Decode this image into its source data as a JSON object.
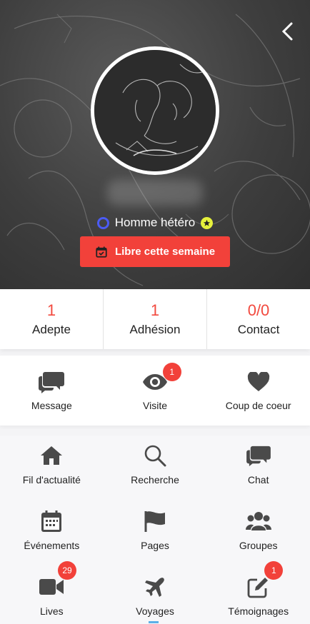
{
  "hero": {
    "orientation_label": "Homme hétéro",
    "availability_button": "Libre cette semaine"
  },
  "stats": [
    {
      "value": "1",
      "label": "Adepte"
    },
    {
      "value": "1",
      "label": "Adhésion"
    },
    {
      "value": "0/0",
      "label": "Contact"
    }
  ],
  "actions": [
    {
      "label": "Message",
      "icon": "chat-bubbles-icon"
    },
    {
      "label": "Visite",
      "icon": "eye-icon",
      "badge": "1"
    },
    {
      "label": "Coup de coeur",
      "icon": "heart-icon"
    }
  ],
  "menu": [
    {
      "label": "Fil d'actualité",
      "icon": "home-icon"
    },
    {
      "label": "Recherche",
      "icon": "search-icon"
    },
    {
      "label": "Chat",
      "icon": "chat-icon"
    },
    {
      "label": "Événements",
      "icon": "calendar-icon"
    },
    {
      "label": "Pages",
      "icon": "flag-icon"
    },
    {
      "label": "Groupes",
      "icon": "group-icon"
    },
    {
      "label": "Lives",
      "icon": "video-icon",
      "badge": "29"
    },
    {
      "label": "Voyages",
      "icon": "plane-icon"
    },
    {
      "label": "Témoignages",
      "icon": "edit-icon",
      "badge": "1"
    }
  ],
  "colors": {
    "accent": "#f2413a",
    "ring": "#4b5bf4",
    "icon": "#4a4a4a"
  }
}
